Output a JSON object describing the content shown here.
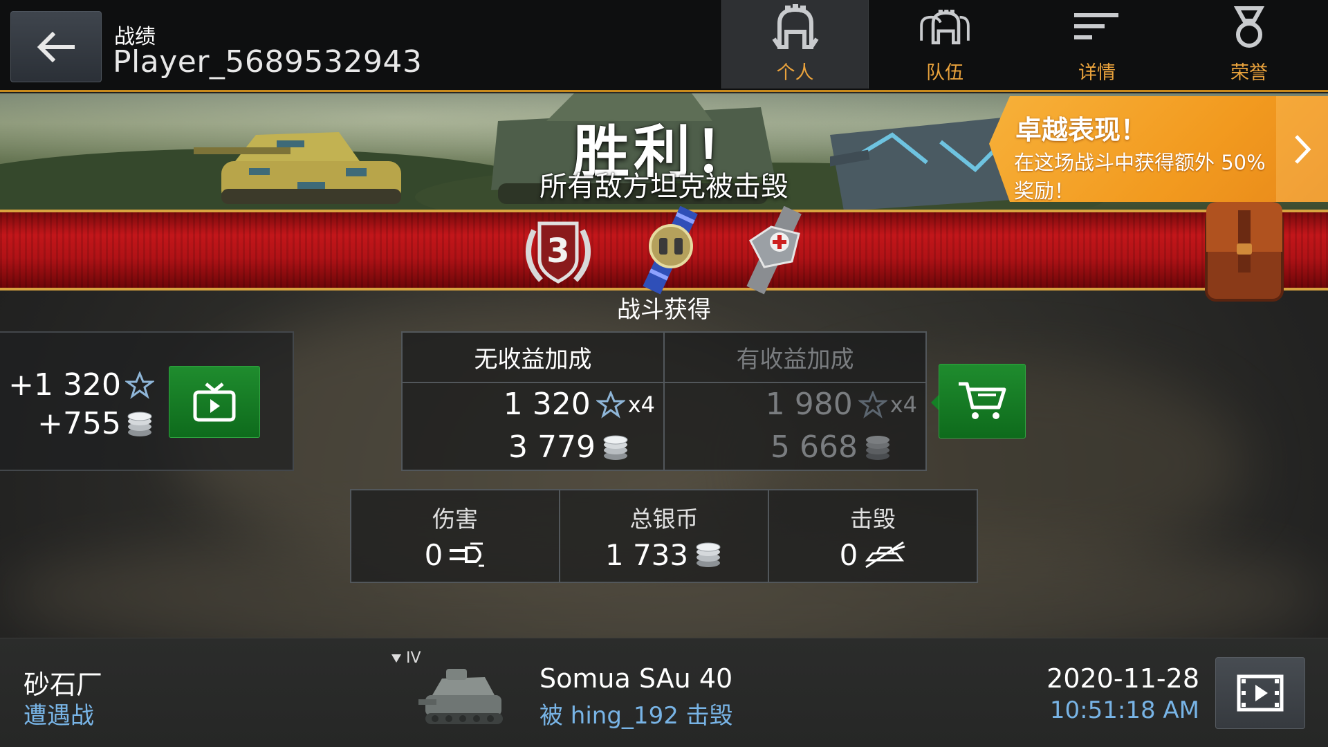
{
  "header": {
    "back_icon": "arrow-left-icon",
    "title": "战绩",
    "player_name": "Player_5689532943",
    "tabs": [
      {
        "label": "个人",
        "icon": "helmet-icon",
        "active": true
      },
      {
        "label": "队伍",
        "icon": "team-helmets-icon",
        "active": false
      },
      {
        "label": "详情",
        "icon": "details-lines-icon",
        "active": false
      },
      {
        "label": "荣誉",
        "icon": "medal-icon",
        "active": false
      }
    ],
    "accent_color": "#e9a23c"
  },
  "banner": {
    "result_title": "胜利！",
    "result_subtitle": "所有敌方坦克被击毁"
  },
  "promo": {
    "title": "卓越表现！",
    "text": "在这场战斗中获得额外 50% 奖励！",
    "arrow_icon": "chevron-right-icon",
    "color": "#f29a1f"
  },
  "ribbon": {
    "medals": [
      {
        "name": "mastery-class-3-badge-icon",
        "text": "3"
      },
      {
        "name": "binoculars-medal-icon"
      },
      {
        "name": "repair-medic-medal-icon"
      }
    ],
    "earned_label": "战斗获得",
    "backpack_icon": "backpack-icon"
  },
  "left_panel": {
    "xp": "+1 320",
    "silver": "+755",
    "watch_ad_icon": "tv-play-icon"
  },
  "reward_table": {
    "no_bonus": {
      "header": "无收益加成",
      "xp": "1 320",
      "multiplier": "x4",
      "silver": "3 779"
    },
    "with_bonus": {
      "header": "有收益加成",
      "xp": "1 980",
      "multiplier": "x4",
      "silver": "5 668"
    },
    "cart_icon": "shopping-cart-icon"
  },
  "stats": [
    {
      "label": "伤害",
      "value": "0",
      "icon": "damage-shell-icon"
    },
    {
      "label": "总银币",
      "value": "1 733",
      "icon": "silver-coins-icon"
    },
    {
      "label": "击毁",
      "value": "0",
      "icon": "kills-tank-crossed-icon"
    }
  ],
  "footer": {
    "map": "砂石厂",
    "mode": "遭遇战",
    "tier": "IV",
    "tank_name": "Somua SAu 40",
    "killed_by": "被 hing_192 击毁",
    "date": "2020-11-28",
    "time": "10:51:18 AM",
    "replay_icon": "film-play-icon",
    "secondary_color": "#78b4e6"
  }
}
